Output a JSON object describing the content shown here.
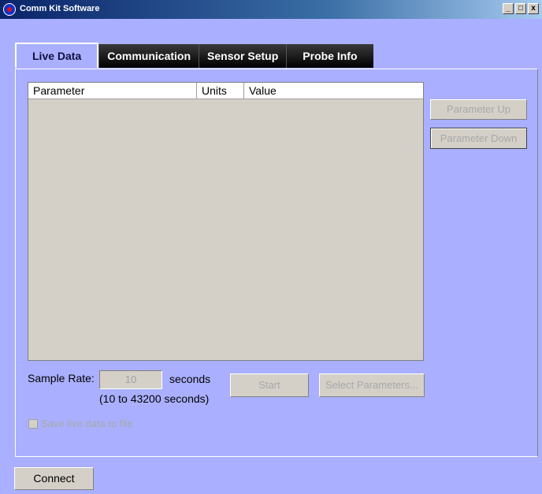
{
  "window": {
    "title": "Comm Kit Software",
    "buttons": [
      "_",
      "□",
      "x"
    ]
  },
  "tabs": [
    {
      "label": "Live Data"
    },
    {
      "label": "Communication"
    },
    {
      "label": "Sensor Setup"
    },
    {
      "label": "Probe Info"
    }
  ],
  "table": {
    "columns": [
      "Parameter",
      "Units",
      "Value"
    ]
  },
  "buttons": {
    "param_up": "Parameter Up",
    "param_down": "Parameter Down",
    "start": "Start",
    "select_params": "Select Parameters...",
    "connect": "Connect"
  },
  "sample_rate": {
    "label": "Sample Rate:",
    "value": "10",
    "unit": "seconds",
    "range": "(10 to 43200 seconds)"
  },
  "save_checkbox": {
    "label": "Save live data to file",
    "checked": false
  }
}
